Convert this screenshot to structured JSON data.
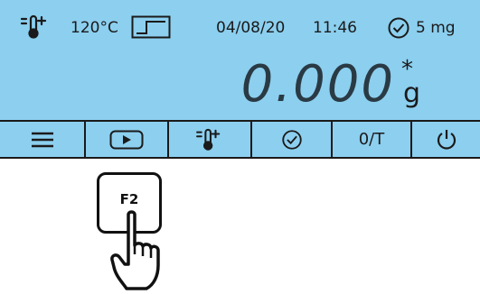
{
  "status": {
    "temperature": "120°C",
    "date": "04/08/20",
    "time": "11:46",
    "readability": "5 mg"
  },
  "weight": {
    "value": "0.000",
    "stability_mark": "*",
    "unit": "g"
  },
  "softkeys": [
    {
      "label": "",
      "icon": "menu-icon"
    },
    {
      "label": "",
      "icon": "play-icon"
    },
    {
      "label": "",
      "icon": "heater-icon"
    },
    {
      "label": "",
      "icon": "timer-icon"
    },
    {
      "label": "0/T",
      "icon": ""
    },
    {
      "label": "",
      "icon": "power-icon"
    }
  ],
  "f2_key": {
    "label": "F2"
  },
  "colors": {
    "display_background": "#8ccfef",
    "frame": "#1a1a1a"
  }
}
